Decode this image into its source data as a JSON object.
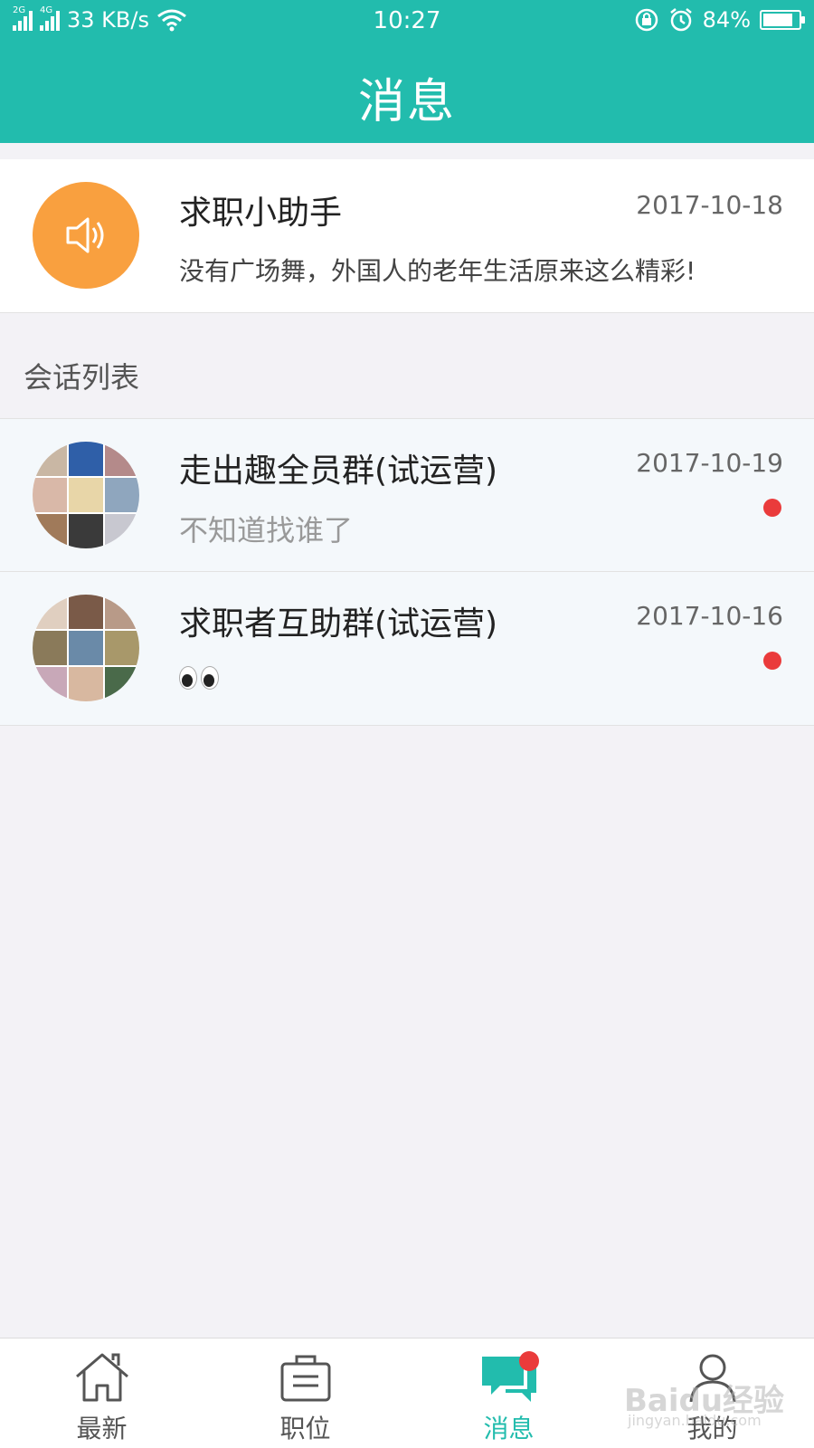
{
  "status_bar": {
    "network_a": "2G",
    "network_b": "4G",
    "speed": "33 KB/s",
    "time": "10:27",
    "battery": "84%",
    "battery_level": 0.84
  },
  "header": {
    "title": "消息"
  },
  "assistant": {
    "name": "求职小助手",
    "date": "2017-10-18",
    "preview": "没有广场舞，外国人的老年生活原来这么精彩!"
  },
  "section": {
    "label": "会话列表"
  },
  "conversations": [
    {
      "name": "走出趣全员群(试运营)",
      "date": "2017-10-19",
      "preview": "不知道找谁了",
      "unread": true
    },
    {
      "name": "求职者互助群(试运营)",
      "date": "2017-10-16",
      "preview_icon": "eyes-emoji",
      "unread": true
    }
  ],
  "colors": {
    "accent": "#22bcad",
    "assistant_avatar": "#f9a03f",
    "unread": "#ea3b3b"
  },
  "nav": {
    "items": [
      {
        "label": "最新",
        "icon": "home-icon"
      },
      {
        "label": "职位",
        "icon": "briefcase-icon"
      },
      {
        "label": "消息",
        "icon": "chat-icon",
        "active": true,
        "badge": true
      },
      {
        "label": "我的",
        "icon": "user-icon"
      }
    ]
  },
  "watermark": {
    "text": "Baidu经验",
    "sub": "jingyan.baidu.com"
  }
}
